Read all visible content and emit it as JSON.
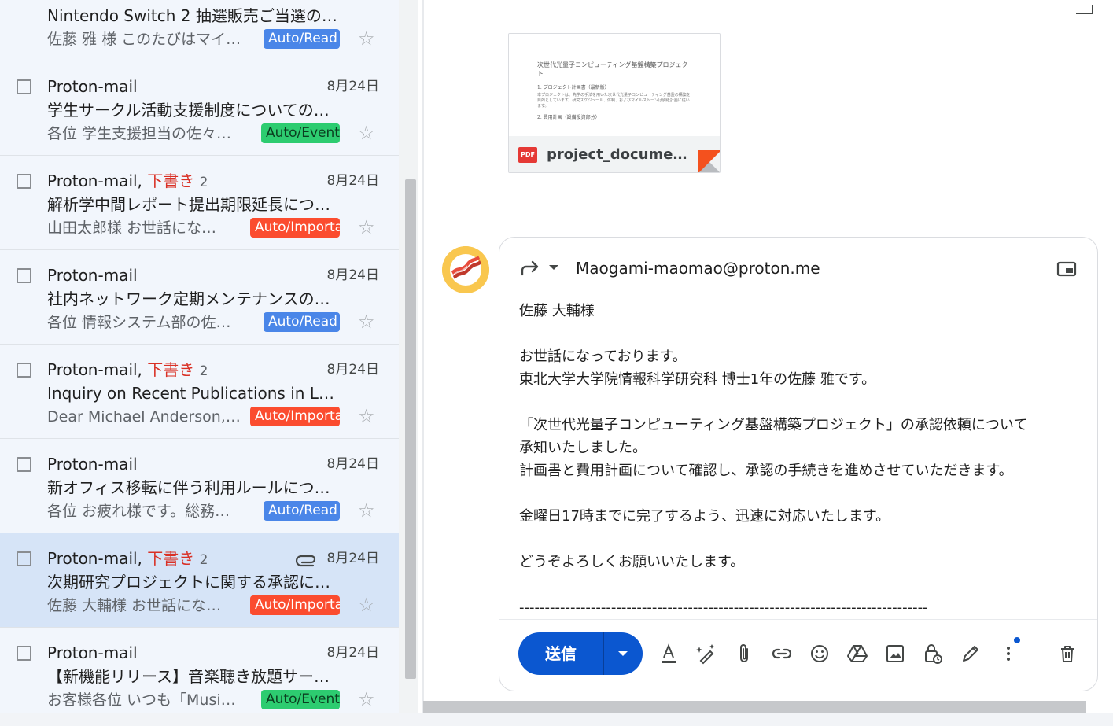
{
  "mail_list": {
    "partial_top": {
      "subject": "Nintendo Switch 2 抽選販売ご当選のお…",
      "snippet": "佐藤 雅 様 このたびはマイ…",
      "label": "Auto/Read"
    },
    "rows": [
      {
        "sender": "Proton-mail",
        "draft": "",
        "count": "",
        "date": "8月24日",
        "subject": "学生サークル活動支援制度についての…",
        "snippet": "各位 学生支援担当の佐々…",
        "label": "Auto/Event"
      },
      {
        "sender": "Proton-mail,",
        "draft": "下書き",
        "count": "2",
        "date": "8月24日",
        "subject": "解析学中間レポート提出期限延長につ…",
        "snippet": "山田太郎様 お世話にな…",
        "label": "Auto/Importa"
      },
      {
        "sender": "Proton-mail",
        "draft": "",
        "count": "",
        "date": "8月24日",
        "subject": "社内ネットワーク定期メンテナンスの…",
        "snippet": "各位 情報システム部の佐…",
        "label": "Auto/Read"
      },
      {
        "sender": "Proton-mail,",
        "draft": "下書き",
        "count": "2",
        "date": "8月24日",
        "subject": "Inquiry on Recent Publications in Larg…",
        "snippet": "Dear Michael Anderson,…",
        "label": "Auto/Importa"
      },
      {
        "sender": "Proton-mail",
        "draft": "",
        "count": "",
        "date": "8月24日",
        "subject": "新オフィス移転に伴う利用ルールにつ…",
        "snippet": "各位 お疲れ様です。総務…",
        "label": "Auto/Read"
      },
      {
        "sender": "Proton-mail,",
        "draft": "下書き",
        "count": "2",
        "date": "8月24日",
        "subject": "次期研究プロジェクトに関する承認に…",
        "snippet": "佐藤 大輔様 お世話にな…",
        "label": "Auto/Importa"
      },
      {
        "sender": "Proton-mail",
        "draft": "",
        "count": "",
        "date": "8月24日",
        "subject": "【新機能リリース】音楽聴き放題サー…",
        "snippet": "お客様各位 いつも「Musi…",
        "label": "Auto/Event"
      }
    ]
  },
  "attachment": {
    "file_name": "project_documen…",
    "pdf_badge": "PDF",
    "preview_title": "次世代光量子コンピューティング基盤構築プロジェクト",
    "preview_section1": "1. プロジェクト計画書（最新版）",
    "preview_paragraph": "本プロジェクトは、先学の手法を用いた次世代光量子コンピューティング基盤の構築を目的としています。研究スケジュール、体制、およびマイルストーンは別紙計画に従います。",
    "preview_section2": "2. 費用計画（設備投資部分）"
  },
  "compose": {
    "recipient": "Maogami-maomao@proton.me",
    "body": {
      "greeting": "佐藤 大輔様",
      "line1": "お世話になっております。",
      "line2": "東北大学大学院情報科学研究科 博士1年の佐藤 雅です。",
      "line3": "「次世代光量子コンピューティング基盤構築プロジェクト」の承認依頼について",
      "line4": "承知いたしました。",
      "line5": "計画書と費用計画について確認し、承認の手続きを進めさせていただきます。",
      "line6": "金曜日17時までに完了するよう、迅速に対応いたします。",
      "line7": "どうぞよろしくお願いいたします。",
      "signature_rule": "--------------------------------------------------------------------------------"
    },
    "send_label": "送信"
  },
  "colors": {
    "label_read": "#4a86e8",
    "label_event": "#2dcc70",
    "label_important": "#fb4c2f",
    "send_button": "#0b57d0",
    "draft_text": "#d93025",
    "selected_row": "#d6e4f7"
  },
  "icons": [
    "star-icon",
    "paperclip-icon",
    "reply-icon",
    "chevron-down-icon",
    "popout-icon",
    "text-format-icon",
    "magic-pen-icon",
    "attach-icon",
    "link-icon",
    "emoji-icon",
    "drive-icon",
    "image-icon",
    "confidential-lock-icon",
    "signature-pen-icon",
    "more-options-icon",
    "trash-icon"
  ]
}
